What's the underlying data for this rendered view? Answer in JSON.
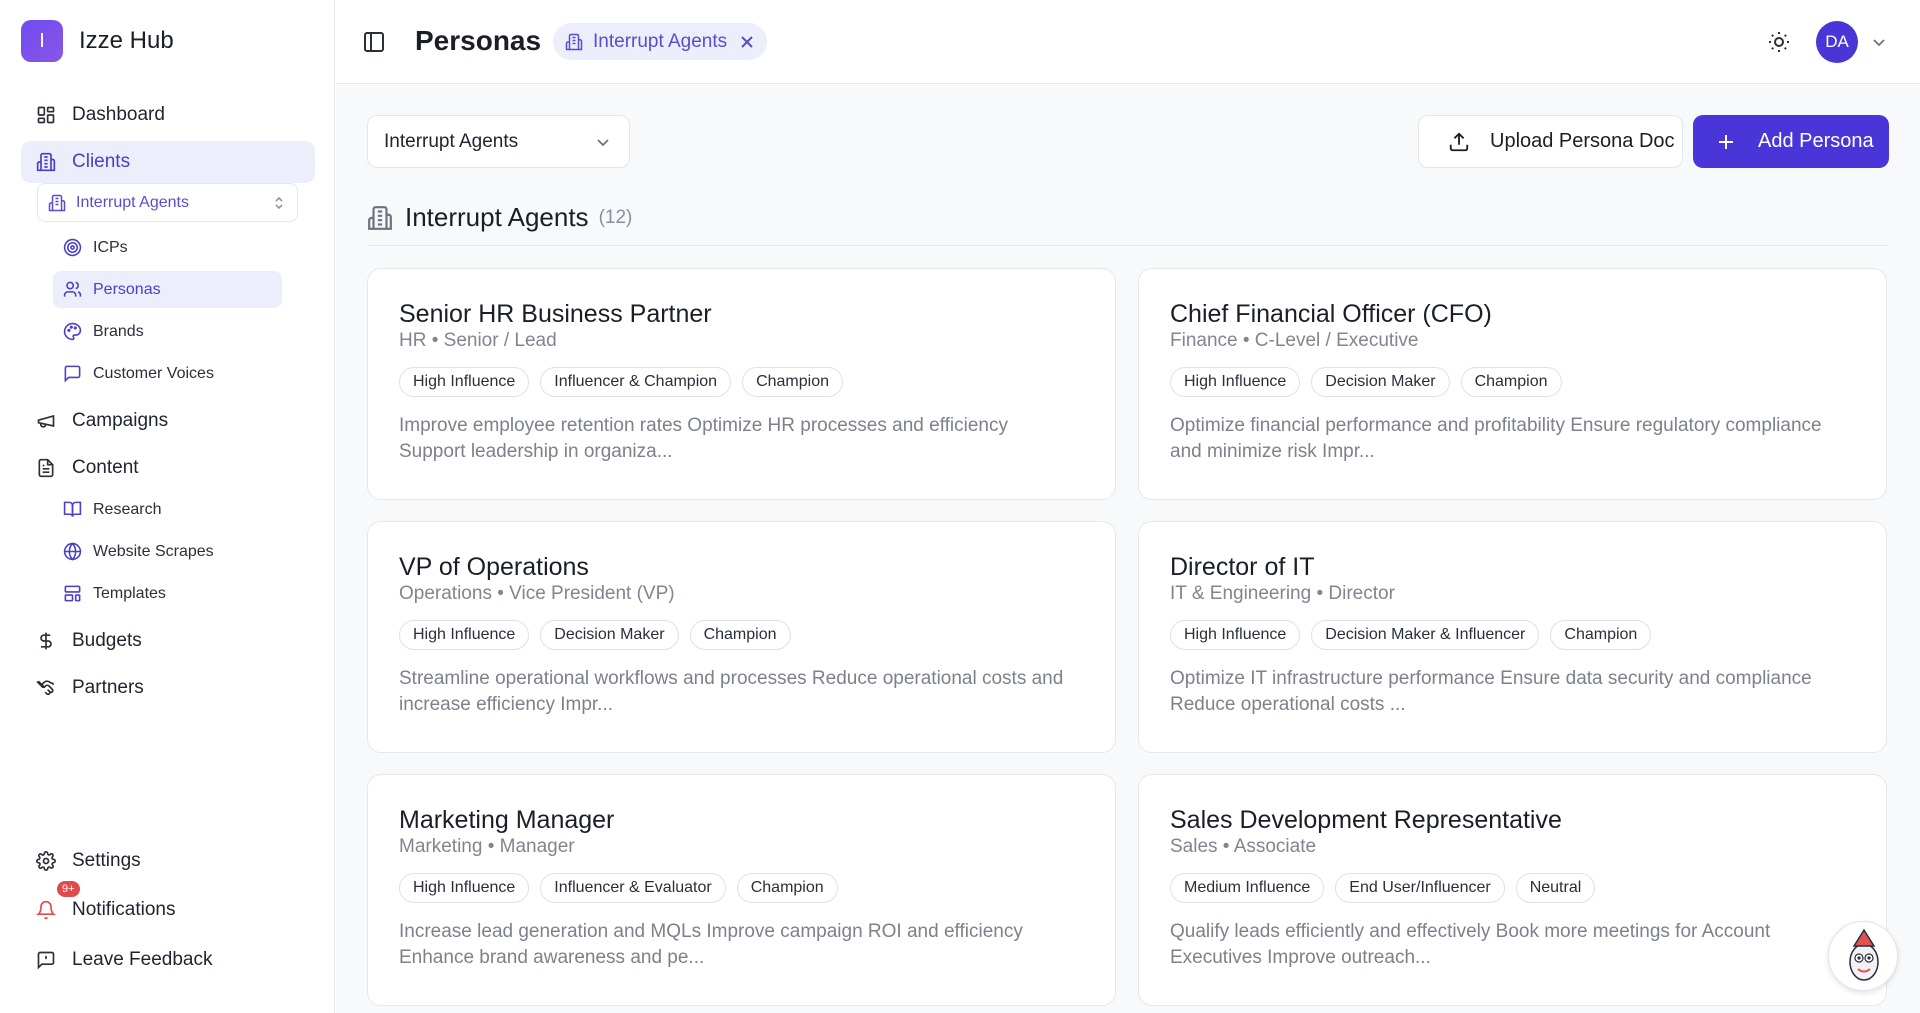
{
  "app": {
    "name": "Izze Hub",
    "logo_letter": "I"
  },
  "sidebar": {
    "items": [
      {
        "label": "Dashboard",
        "icon": "dashboard-icon"
      },
      {
        "label": "Clients",
        "icon": "building-icon"
      },
      {
        "label": "Campaigns",
        "icon": "megaphone-icon"
      },
      {
        "label": "Content",
        "icon": "document-icon"
      },
      {
        "label": "Budgets",
        "icon": "dollar-icon"
      },
      {
        "label": "Partners",
        "icon": "handshake-icon"
      }
    ],
    "client_selector": "Interrupt Agents",
    "client_subitems": [
      {
        "label": "ICPs",
        "icon": "target-icon"
      },
      {
        "label": "Personas",
        "icon": "users-icon"
      },
      {
        "label": "Brands",
        "icon": "palette-icon"
      },
      {
        "label": "Customer Voices",
        "icon": "message-icon"
      }
    ],
    "content_subitems": [
      {
        "label": "Research",
        "icon": "book-icon"
      },
      {
        "label": "Website Scrapes",
        "icon": "globe-icon"
      },
      {
        "label": "Templates",
        "icon": "template-icon"
      }
    ],
    "bottom": {
      "settings": "Settings",
      "notifications": "Notifications",
      "notifications_badge": "9+",
      "feedback": "Leave Feedback"
    }
  },
  "header": {
    "title": "Personas",
    "filter_chip": "Interrupt Agents",
    "avatar_initials": "DA"
  },
  "toolbar": {
    "client_dropdown": "Interrupt Agents",
    "upload_label": "Upload Persona Doc",
    "add_label": "Add Persona"
  },
  "section": {
    "title": "Interrupt Agents",
    "count": "(12)"
  },
  "personas": [
    {
      "title": "Senior HR Business Partner",
      "sub": "HR • Senior / Lead",
      "tags": [
        "High Influence",
        "Influencer & Champion",
        "Champion"
      ],
      "desc": "Improve employee retention rates Optimize HR processes and efficiency Support leadership in organiza..."
    },
    {
      "title": "Chief Financial Officer (CFO)",
      "sub": "Finance • C-Level / Executive",
      "tags": [
        "High Influence",
        "Decision Maker",
        "Champion"
      ],
      "desc": "Optimize financial performance and profitability Ensure regulatory compliance and minimize risk Impr..."
    },
    {
      "title": "VP of Operations",
      "sub": "Operations • Vice President (VP)",
      "tags": [
        "High Influence",
        "Decision Maker",
        "Champion"
      ],
      "desc": "Streamline operational workflows and processes Reduce operational costs and increase efficiency Impr..."
    },
    {
      "title": "Director of IT",
      "sub": "IT & Engineering • Director",
      "tags": [
        "High Influence",
        "Decision Maker & Influencer",
        "Champion"
      ],
      "desc": "Optimize IT infrastructure performance Ensure data security and compliance Reduce operational costs ..."
    },
    {
      "title": "Marketing Manager",
      "sub": "Marketing • Manager",
      "tags": [
        "High Influence",
        "Influencer & Evaluator",
        "Champion"
      ],
      "desc": "Increase lead generation and MQLs Improve campaign ROI and efficiency Enhance brand awareness and pe..."
    },
    {
      "title": "Sales Development Representative",
      "sub": "Sales • Associate",
      "tags": [
        "Medium Influence",
        "End User/Influencer",
        "Neutral"
      ],
      "desc": "Qualify leads efficiently and effectively Book more meetings for Account Executives Improve outreach..."
    }
  ],
  "colors": {
    "accent": "#4a35d8",
    "active_bg": "#eceefb",
    "badge": "#e24b4b"
  }
}
